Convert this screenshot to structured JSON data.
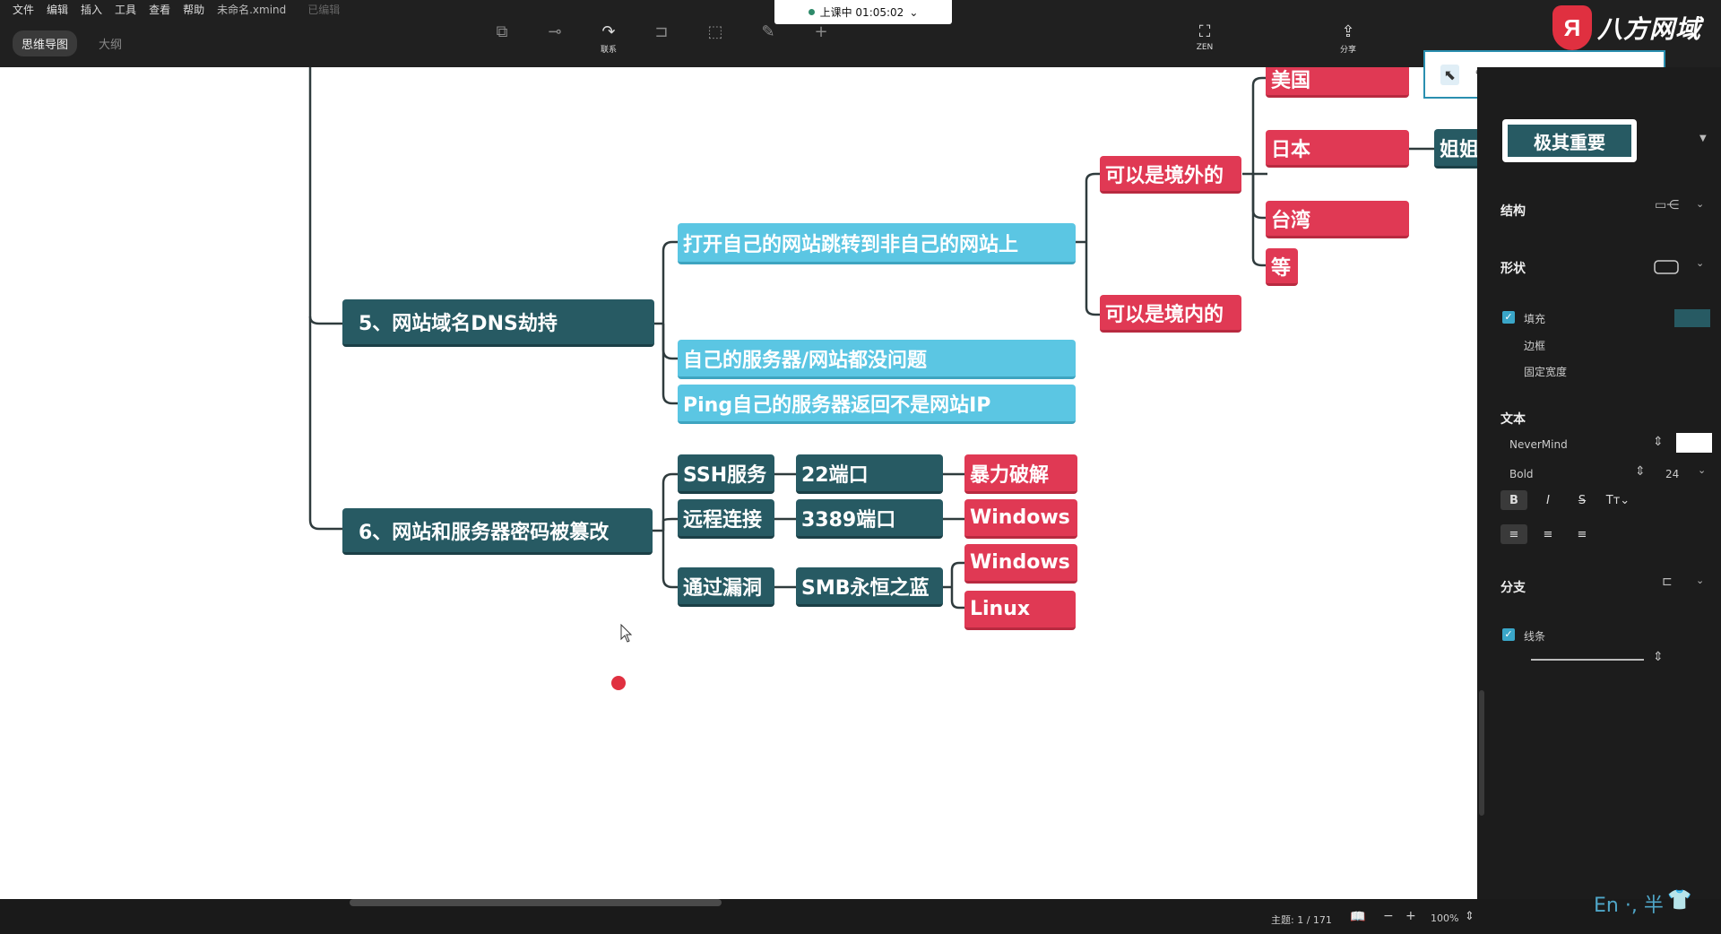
{
  "menu": {
    "items": [
      "文件",
      "编辑",
      "插入",
      "工具",
      "查看",
      "帮助"
    ],
    "filename": "未命名.xmind",
    "saved": "已编辑"
  },
  "mode_tabs": {
    "mindmap": "思维导图",
    "outline": "大纲"
  },
  "toolbar": {
    "relation": "联系",
    "zen": "ZEN",
    "share": "分享"
  },
  "recording": {
    "status": "上课中 01:05:02"
  },
  "brand": {
    "logo_char": "Я",
    "name": "八方网域"
  },
  "mindmap": {
    "topic5": "5、网站域名DNS劫持",
    "topic5_a": "打开自己的网站跳转到非自己的网站上",
    "topic5_a1": "可以是境外的",
    "topic5_a2": "可以是境内的",
    "country_us": "美国",
    "country_jp": "日本",
    "country_tw": "台湾",
    "country_etc": "等",
    "sister": "姐姐",
    "topic5_b": "自己的服务器/网站都没问题",
    "topic5_c": "Ping自己的服务器返回不是网站IP",
    "topic6": "6、网站和服务器密码被篡改",
    "ssh": "SSH服务",
    "port22": "22端口",
    "brute": "暴力破解",
    "remote": "远程连接",
    "port3389": "3389端口",
    "win1": "Windows",
    "vuln": "通过漏洞",
    "smb": "SMB永恒之蓝",
    "win2": "Windows",
    "linux": "Linux"
  },
  "panel": {
    "style_label": "极其重要",
    "structure": "结构",
    "shape": "形状",
    "fill": "填充",
    "border": "边框",
    "fixed_width": "固定宽度",
    "text": "文本",
    "font": "NeverMind",
    "weight": "Bold",
    "size": "24",
    "branch": "分支",
    "line": "线条"
  },
  "status": {
    "topics": "主题: 1 / 171",
    "zoom": "100%"
  },
  "ime": "En ·, 半",
  "colors": {
    "dark": "#275a63",
    "blue": "#5bc6e3",
    "red": "#e03954"
  }
}
